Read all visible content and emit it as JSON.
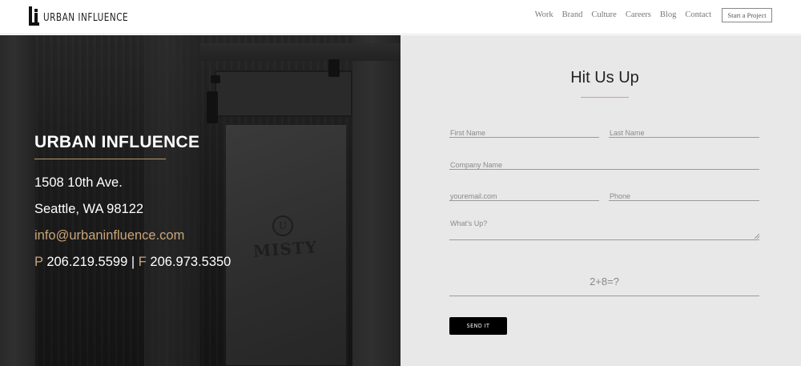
{
  "header": {
    "logo_text": "URBAN INFLUENCE",
    "nav": [
      "Work",
      "Brand",
      "Culture",
      "Careers",
      "Blog",
      "Contact"
    ],
    "cta_label": "Start a Project"
  },
  "contact": {
    "company": "URBAN INFLUENCE",
    "address_line1": "1508 10th Ave.",
    "address_line2": "Seattle, WA 98122",
    "email": "info@urbaninfluence.com",
    "phone_prefix": "P",
    "phone": "206.219.5599",
    "separator": "|",
    "fax_prefix": "F",
    "fax": "206.973.5350",
    "image_text": "MISTY",
    "image_monogram": "U"
  },
  "form": {
    "title": "Hit Us Up",
    "first_name_placeholder": "First Name",
    "last_name_placeholder": "Last Name",
    "company_placeholder": "Company Name",
    "email_placeholder": "youremail.com",
    "phone_placeholder": "Phone",
    "message_placeholder": "What's Up?",
    "captcha": "2+8=?",
    "submit_label": "SEND IT"
  },
  "colors": {
    "accent_gold": "#c9a57a",
    "form_bg": "#e8e8e9",
    "dark_bg": "#1a1a1a"
  }
}
